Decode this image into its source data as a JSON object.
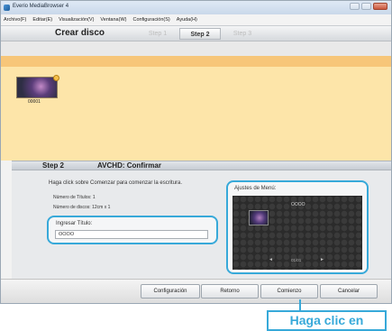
{
  "window": {
    "title": "Everio MediaBrowser 4"
  },
  "menu": {
    "items": [
      "Archivo(F)",
      "Editar(E)",
      "Visualización(V)",
      "Ventana(W)",
      "Configuración(S)",
      "Ayuda(H)"
    ]
  },
  "header": {
    "title": "Crear disco",
    "steps": [
      "Step 1",
      "Step 2",
      "Step 3"
    ],
    "active_step": "Step 2"
  },
  "media": {
    "items": [
      {
        "name": "00001"
      }
    ]
  },
  "step2": {
    "label": "Step 2",
    "title": "AVCHD: Confirmar"
  },
  "details": {
    "instruction": "Haga click sobre Comenzar para comenzar la escritura.",
    "titles_count": "Número de Títulos: 1",
    "disc_count": "Número de discos: 12cm x 1",
    "title_input_label": "Ingresar Título:",
    "title_input_value": "OOOO"
  },
  "menu_settings": {
    "label": "Ajustes de Menú:",
    "preview_title": "OOOO",
    "preview_page": "01/01",
    "prev_icon": "◄",
    "next_icon": "►"
  },
  "footer": {
    "config_label": "Configuración",
    "back_label": "Retorno",
    "start_label": "Comienzo",
    "cancel_label": "Cancelar"
  },
  "callout": {
    "text": "Haga clic en"
  },
  "colors": {
    "accent": "#37a9d9",
    "panel": "#fde5a9",
    "orange_bar": "#f7c679"
  }
}
